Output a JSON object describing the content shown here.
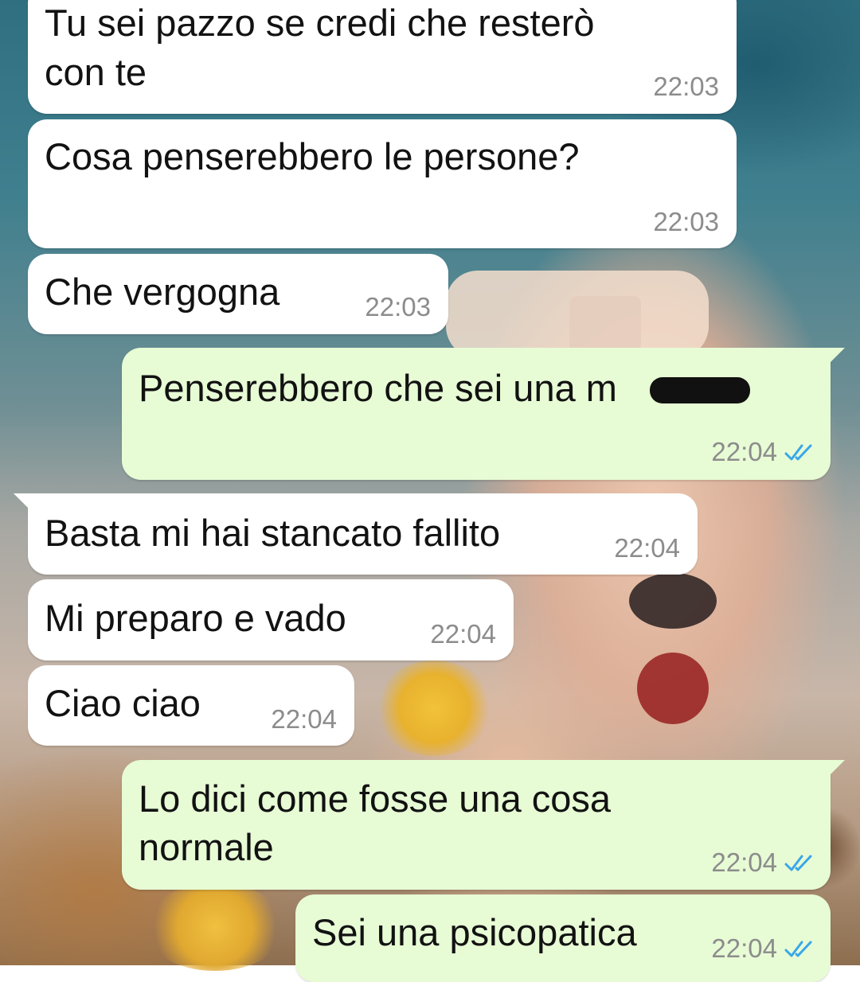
{
  "wallpaper": {
    "description_colors": [
      "#2f6f80",
      "#c8b6a8",
      "#f0c040"
    ]
  },
  "colors": {
    "incoming_bubble": "#ffffff",
    "outgoing_bubble": "#e7fbd5",
    "text": "#121212",
    "timestamp": "#8c8c8c",
    "read_ticks": "#3aa7e8"
  },
  "messages": [
    {
      "direction": "incoming",
      "lines": [
        "Tu sei pazzo se credi che resterò",
        "con te"
      ],
      "time": "22:03"
    },
    {
      "direction": "incoming",
      "lines": [
        "Cosa penserebbero le persone?"
      ],
      "time": "22:03"
    },
    {
      "direction": "incoming",
      "lines": [
        "Che vergogna"
      ],
      "time": "22:03"
    },
    {
      "direction": "outgoing",
      "lines": [
        "Penserebbero che sei una m"
      ],
      "time": "22:04",
      "status": "read",
      "redacted": true
    },
    {
      "direction": "incoming",
      "lines": [
        "Basta mi hai stancato fallito"
      ],
      "time": "22:04"
    },
    {
      "direction": "incoming",
      "lines": [
        "Mi preparo e vado"
      ],
      "time": "22:04"
    },
    {
      "direction": "incoming",
      "lines": [
        "Ciao ciao"
      ],
      "time": "22:04"
    },
    {
      "direction": "outgoing",
      "lines": [
        "Lo dici come fosse una cosa",
        "normale"
      ],
      "time": "22:04",
      "status": "read"
    },
    {
      "direction": "outgoing",
      "lines": [
        "Sei una psicopatica"
      ],
      "time": "22:04",
      "status": "read"
    }
  ]
}
